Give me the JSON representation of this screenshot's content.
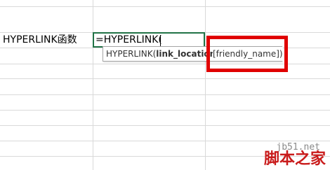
{
  "cells": {
    "a_label": "HYPERLINK函数",
    "formula": "=HYPERLINK("
  },
  "tooltip": {
    "func_prefix": "HYPERLINK(",
    "arg_bold": "link_location",
    "arg_optional": "[friendly_name])"
  },
  "watermark": {
    "url": "jb51.net",
    "name": "脚本之家"
  },
  "colors": {
    "highlight": "#e00000",
    "active_border": "#217346",
    "gridline": "#d9d9d9"
  }
}
